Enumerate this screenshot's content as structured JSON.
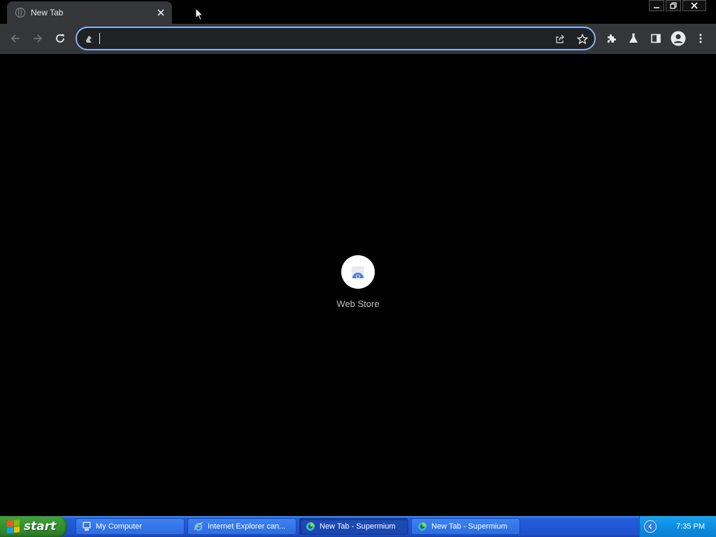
{
  "browser": {
    "tab": {
      "title": "New Tab"
    },
    "omnibox": {
      "value": "",
      "placeholder": ""
    }
  },
  "page": {
    "shortcuts": [
      {
        "label": "Web Store"
      }
    ]
  },
  "taskbar": {
    "start_label": "start",
    "tasks": [
      {
        "label": "My Computer",
        "icon": "my-computer-icon"
      },
      {
        "label": "Internet Explorer can...",
        "icon": "internet-explorer-icon"
      },
      {
        "label": "New Tab - Supermium",
        "icon": "supermium-icon"
      },
      {
        "label": "New Tab - Supermium",
        "icon": "supermium-icon"
      }
    ],
    "clock": "7:35 PM"
  },
  "colors": {
    "accent": "#8ab4f8",
    "toolbar": "#35363a",
    "page_background": "#000000",
    "taskbar_blue": "#245edb",
    "start_green": "#3c9a35"
  }
}
